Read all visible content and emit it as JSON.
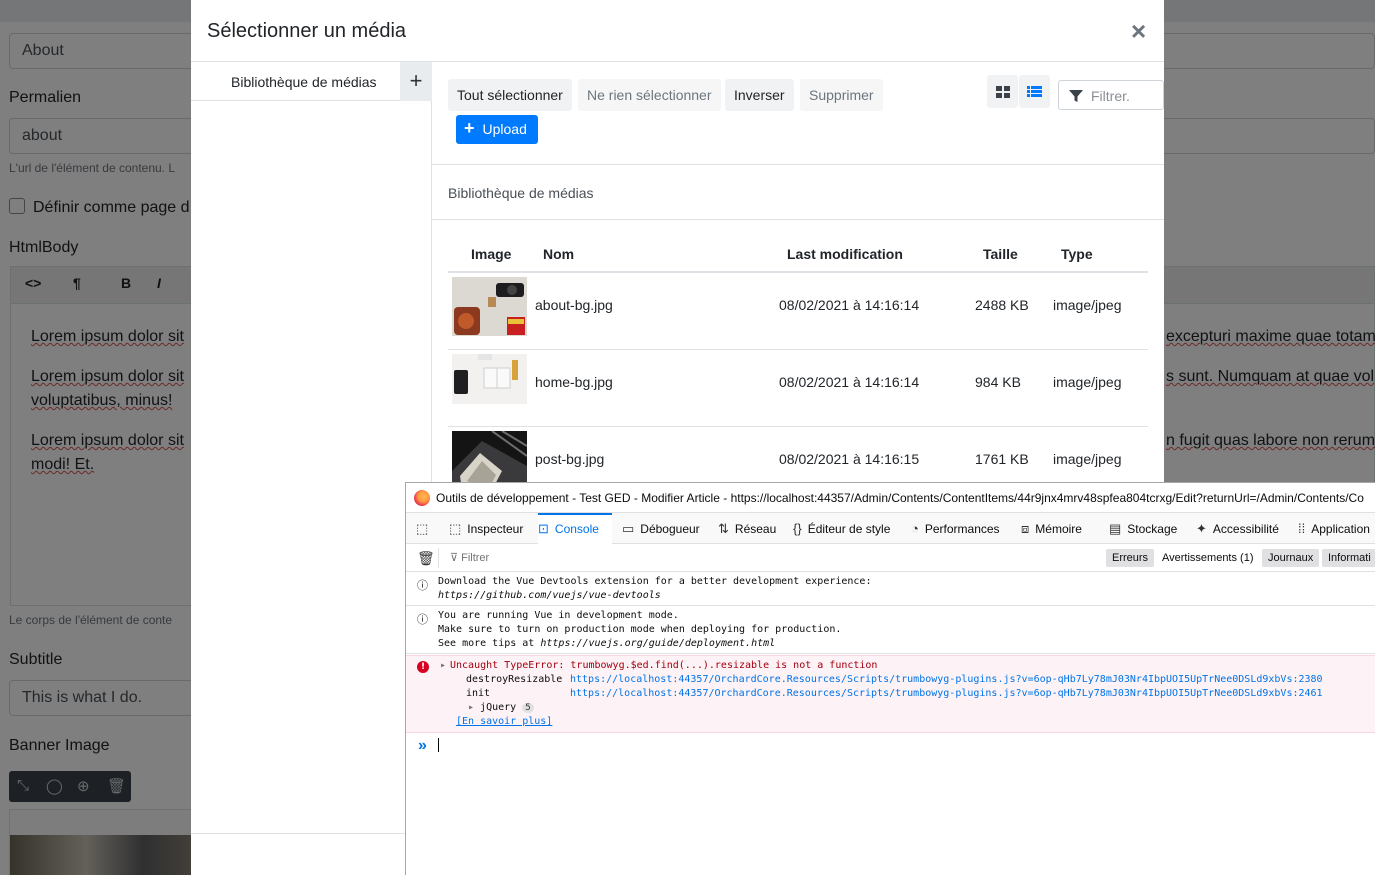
{
  "background": {
    "about_value": "About",
    "permalink_label": "Permalien",
    "permalink_value": "about",
    "permalink_hint": "L'url de l'élément de contenu. L",
    "homepage_checkbox_label": "Définir comme page d",
    "htmlbody_label": "HtmlBody",
    "toolbar": {
      "source": "<>",
      "paragraph": "¶",
      "bold": "B",
      "italic": "I"
    },
    "editor_left": [
      "Lorem ipsum dolor sit",
      "Lorem ipsum dolor sit",
      "voluptatibus, minus!",
      "Lorem ipsum dolor sit",
      "modi! Et."
    ],
    "editor_right": [
      "excepturi maxime quae totam c",
      "s sunt. Numquam at quae vol",
      "n fugit quas labore non rerum"
    ],
    "body_hint": "Le corps de l'élément de conte",
    "subtitle_label": "Subtitle",
    "subtitle_value": "This is what I do.",
    "banner_label": "Banner Image"
  },
  "modal": {
    "title": "Sélectionner un média",
    "close": "×",
    "library_item": "Bibliothèque de médias",
    "add": "+",
    "actions": {
      "select_all": "Tout sélectionner",
      "select_none": "Ne rien sélectionner",
      "invert": "Inverser",
      "delete": "Supprimer"
    },
    "upload": "Upload",
    "upload_icon": "+",
    "filter_placeholder": "Filtrer.",
    "breadcrumb": "Bibliothèque de médias",
    "columns": {
      "image": "Image",
      "name": "Nom",
      "modified": "Last modification",
      "size": "Taille",
      "type": "Type"
    },
    "rows": [
      {
        "name": "about-bg.jpg",
        "modified": "08/02/2021 à 14:16:14",
        "size": "2488 KB",
        "type": "image/jpeg"
      },
      {
        "name": "home-bg.jpg",
        "modified": "08/02/2021 à 14:16:14",
        "size": "984 KB",
        "type": "image/jpeg"
      },
      {
        "name": "post-bg.jpg",
        "modified": "08/02/2021 à 14:16:15",
        "size": "1761 KB",
        "type": "image/jpeg"
      }
    ]
  },
  "devtools": {
    "title": "Outils de développement - Test GED - Modifier Article - https://localhost:44357/Admin/Contents/ContentItems/44r9jnx4mrv48spfea804tcrxg/Edit?returnUrl=/Admin/Contents/Co",
    "tabs": [
      "Inspecteur",
      "Console",
      "Débogueur",
      "Réseau",
      "Éditeur de style",
      "Performances",
      "Mémoire",
      "Stockage",
      "Accessibilité",
      "Application"
    ],
    "filter_placeholder": "Filtrer",
    "levels": [
      "Erreurs",
      "Avertissements (1)",
      "Journaux",
      "Informati"
    ],
    "messages": {
      "m1_l1": "Download the Vue Devtools extension for a better development experience:",
      "m1_l2": "https://github.com/vuejs/vue-devtools",
      "m2_l1": "You are running Vue in development mode.",
      "m2_l2": "Make sure to turn on production mode when deploying for production.",
      "m2_l3_prefix": "See more tips at ",
      "m2_l3_link": "https://vuejs.org/guide/deployment.html",
      "err_title": "Uncaught TypeError: trumbowyg.$ed.find(...).resizable is not a function",
      "err_f1": "destroyResizable",
      "err_u1": "https://localhost:44357/OrchardCore.Resources/Scripts/trumbowyg-plugins.js?v=6op-qHb7Ly78mJ03Nr4IbpUOI5UpTrNee0DSLd9xbVs:2380",
      "err_f2": "init",
      "err_u2": "https://localhost:44357/OrchardCore.Resources/Scripts/trumbowyg-plugins.js?v=6op-qHb7Ly78mJ03Nr4IbpUOI5UpTrNee0DSLd9xbVs:2461",
      "err_f3": "jQuery",
      "err_f3_count": "5",
      "learn_more": "[En savoir plus]"
    },
    "prompt": "»"
  }
}
